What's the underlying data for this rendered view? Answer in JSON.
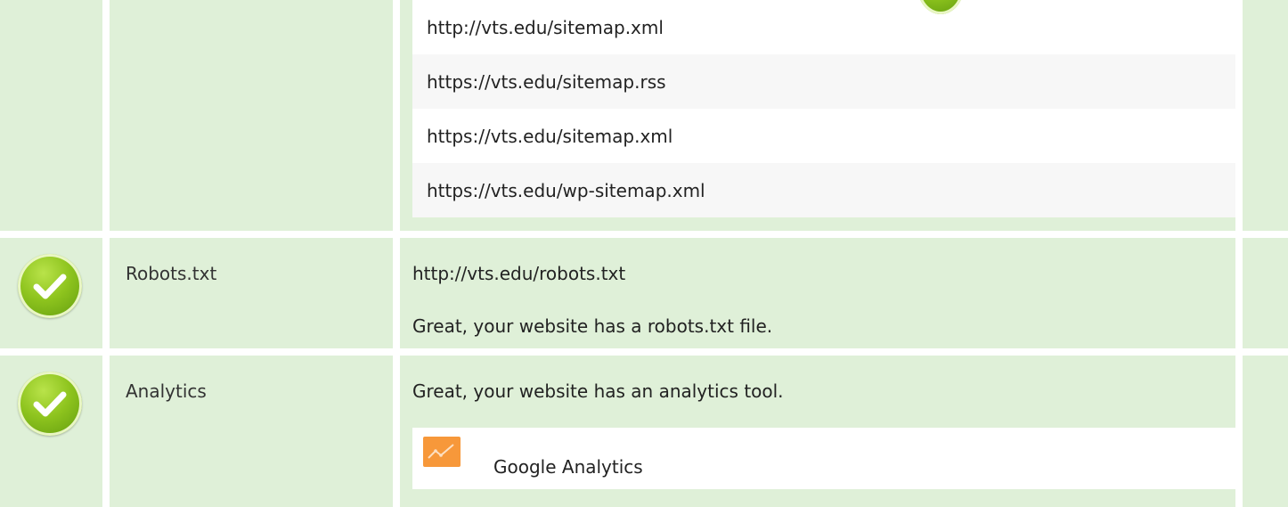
{
  "sitemaps": {
    "items": [
      "http://vts.edu/sitemap.xml",
      "https://vts.edu/sitemap.rss",
      "https://vts.edu/sitemap.xml",
      "https://vts.edu/wp-sitemap.xml"
    ]
  },
  "robots": {
    "label": "Robots.txt",
    "url": "http://vts.edu/robots.txt",
    "message": "Great, your website has a robots.txt file.",
    "status_icon": "check-circle-icon"
  },
  "analytics": {
    "label": "Analytics",
    "message": "Great, your website has an analytics tool.",
    "status_icon": "check-circle-icon",
    "tool": {
      "name": "Google Analytics",
      "icon": "google-analytics-icon"
    }
  },
  "colors": {
    "row_background": "#dff0d8",
    "check_green": "#8ec41e",
    "analytics_orange": "#f7983a"
  }
}
